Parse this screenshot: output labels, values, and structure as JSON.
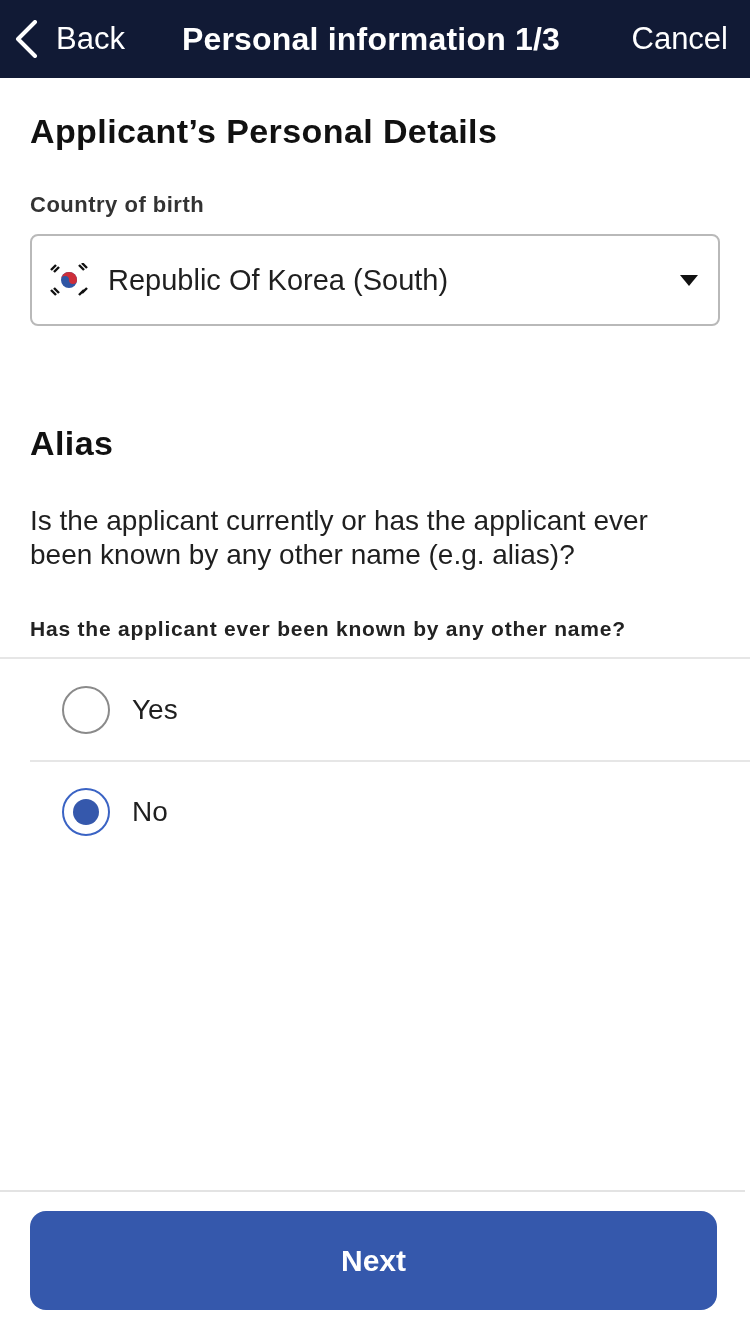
{
  "header": {
    "back": "Back",
    "title": "Personal information 1/3",
    "cancel": "Cancel"
  },
  "section_title": "Applicant’s Personal Details",
  "country_field": {
    "label": "Country of birth",
    "value": "Republic Of Korea (South)"
  },
  "alias": {
    "title": "Alias",
    "description": "Is the applicant currently or has the applicant ever been known by any other name (e.g. alias)?",
    "question": "Has the applicant ever been known by any other name?",
    "options": [
      {
        "label": "Yes",
        "selected": false
      },
      {
        "label": "No",
        "selected": true
      }
    ]
  },
  "next_button": "Next"
}
